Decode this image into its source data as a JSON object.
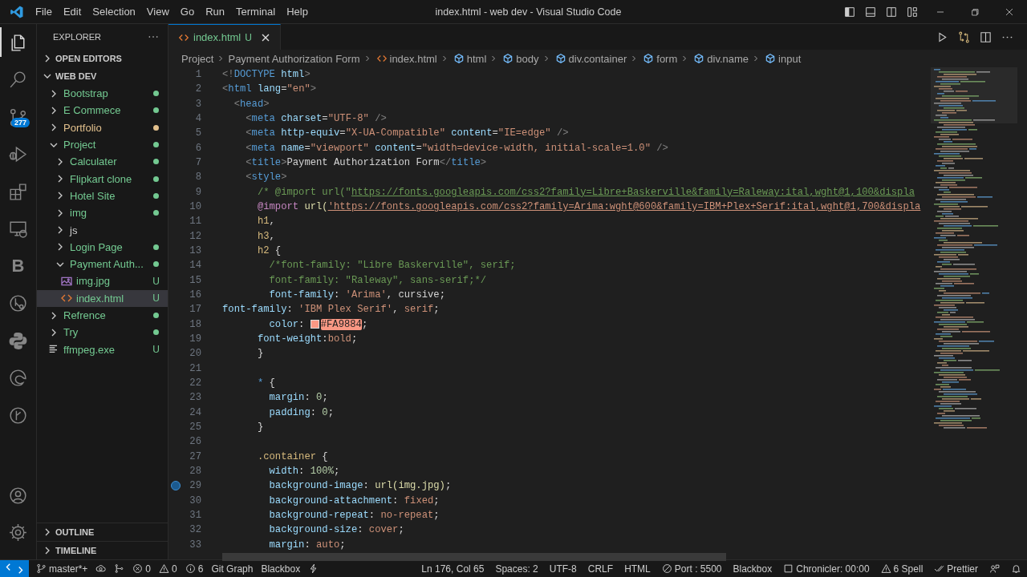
{
  "window": {
    "title": "index.html - web dev - Visual Studio Code"
  },
  "menu": [
    "File",
    "Edit",
    "Selection",
    "View",
    "Go",
    "Run",
    "Terminal",
    "Help"
  ],
  "activity_bar": {
    "top": [
      {
        "kind": "files",
        "selected": true
      },
      {
        "kind": "search",
        "selected": false
      },
      {
        "kind": "source-control",
        "selected": false,
        "badge": "277"
      },
      {
        "kind": "run-debug",
        "selected": false
      },
      {
        "kind": "extensions",
        "selected": false
      },
      {
        "kind": "remote",
        "selected": false
      },
      {
        "kind": "letter",
        "selected": false,
        "text": "B"
      },
      {
        "kind": "git-lens",
        "selected": false
      },
      {
        "kind": "python",
        "selected": false
      },
      {
        "kind": "edge",
        "selected": false
      },
      {
        "kind": "git-graph",
        "selected": false
      }
    ],
    "bottom": [
      {
        "kind": "account"
      },
      {
        "kind": "settings"
      }
    ]
  },
  "sidebar": {
    "title": "EXPLORER",
    "sections": [
      {
        "label": "OPEN EDITORS",
        "expanded": false
      },
      {
        "label": "WEB DEV",
        "expanded": true,
        "items": [
          {
            "name": "Bootstrap",
            "kind": "folder",
            "expanded": false,
            "color": "#73c991",
            "dot": true,
            "selected": false
          },
          {
            "name": "E Commece",
            "kind": "folder",
            "expanded": false,
            "color": "#73c991",
            "dot": true,
            "selected": false
          },
          {
            "name": "Portfolio",
            "kind": "folder",
            "expanded": false,
            "color": "#e2c08d",
            "dot": true,
            "selected": false
          },
          {
            "name": "Project",
            "kind": "folder",
            "expanded": true,
            "color": "#73c991",
            "dot": true,
            "selected": false,
            "children": [
              {
                "name": "Calculater",
                "kind": "folder",
                "expanded": false,
                "color": "#73c991",
                "dot": true,
                "selected": false
              },
              {
                "name": "Flipkart clone",
                "kind": "folder",
                "expanded": false,
                "color": "#73c991",
                "dot": true,
                "selected": false
              },
              {
                "name": "Hotel Site",
                "kind": "folder",
                "expanded": false,
                "color": "#73c991",
                "dot": true,
                "selected": false
              },
              {
                "name": "img",
                "kind": "folder",
                "expanded": false,
                "color": "#73c991",
                "dot": true,
                "selected": false
              },
              {
                "name": "js",
                "kind": "folder",
                "expanded": false,
                "color": "#cccccc",
                "dot": false,
                "selected": false
              },
              {
                "name": "Login Page",
                "kind": "folder",
                "expanded": false,
                "color": "#73c991",
                "dot": true,
                "selected": false
              },
              {
                "name": "Payment Auth...",
                "kind": "folder",
                "expanded": true,
                "color": "#73c991",
                "dot": true,
                "selected": false,
                "children": [
                  {
                    "name": "img.jpg",
                    "kind": "image",
                    "color": "#73c991",
                    "dot": false,
                    "badge": "U",
                    "selected": false
                  },
                  {
                    "name": "index.html",
                    "kind": "html",
                    "color": "#73c991",
                    "dot": false,
                    "badge": "U",
                    "selected": true
                  }
                ]
              }
            ]
          },
          {
            "name": "Refrence",
            "kind": "folder",
            "expanded": false,
            "color": "#73c991",
            "dot": true,
            "selected": false
          },
          {
            "name": "Try",
            "kind": "folder",
            "expanded": false,
            "color": "#73c991",
            "dot": true,
            "selected": false
          },
          {
            "name": "ffmpeg.exe",
            "kind": "text",
            "color": "#73c991",
            "dot": false,
            "badge": "U",
            "selected": false
          }
        ]
      },
      {
        "label": "OUTLINE",
        "expanded": false
      },
      {
        "label": "TIMELINE",
        "expanded": false
      }
    ]
  },
  "editor": {
    "tabs": [
      {
        "label": "index.html",
        "badge": "U",
        "selected": true
      }
    ],
    "breadcrumbs": [
      {
        "text": "Project",
        "kind": "folder"
      },
      {
        "text": "Payment Authorization Form",
        "kind": "folder"
      },
      {
        "text": "index.html",
        "kind": "file"
      },
      {
        "text": "html",
        "kind": "element"
      },
      {
        "text": "body",
        "kind": "element"
      },
      {
        "text": "div.container",
        "kind": "element"
      },
      {
        "text": "form",
        "kind": "element"
      },
      {
        "text": "div.name",
        "kind": "element"
      },
      {
        "text": "input",
        "kind": "element"
      }
    ],
    "lines": [
      {
        "n": "1",
        "marker": false,
        "tokens": [
          {
            "kind": "punct",
            "text": "<!"
          },
          {
            "kind": "tag",
            "text": "DOCTYPE"
          },
          {
            "kind": "attr",
            "text": " html"
          },
          {
            "kind": "punct",
            "text": ">"
          }
        ]
      },
      {
        "n": "2",
        "marker": false,
        "tokens": [
          {
            "kind": "punct",
            "text": "<"
          },
          {
            "kind": "tag",
            "text": "html"
          },
          {
            "kind": "attr",
            "text": " lang"
          },
          {
            "kind": "plain",
            "text": "="
          },
          {
            "kind": "string",
            "text": "\"en\""
          },
          {
            "kind": "punct",
            "text": ">"
          }
        ]
      },
      {
        "n": "3",
        "marker": false,
        "tokens": [
          {
            "kind": "punct",
            "text": "  <"
          },
          {
            "kind": "tag",
            "text": "head"
          },
          {
            "kind": "punct",
            "text": ">"
          }
        ]
      },
      {
        "n": "4",
        "marker": false,
        "tokens": [
          {
            "kind": "punct",
            "text": "    <"
          },
          {
            "kind": "tag",
            "text": "meta"
          },
          {
            "kind": "attr",
            "text": " charset"
          },
          {
            "kind": "plain",
            "text": "="
          },
          {
            "kind": "string",
            "text": "\"UTF-8\""
          },
          {
            "kind": "punct",
            "text": " />"
          }
        ]
      },
      {
        "n": "5",
        "marker": false,
        "tokens": [
          {
            "kind": "punct",
            "text": "    <"
          },
          {
            "kind": "tag",
            "text": "meta"
          },
          {
            "kind": "attr",
            "text": " http-equiv"
          },
          {
            "kind": "plain",
            "text": "="
          },
          {
            "kind": "string",
            "text": "\"X-UA-Compatible\""
          },
          {
            "kind": "attr",
            "text": " content"
          },
          {
            "kind": "plain",
            "text": "="
          },
          {
            "kind": "string",
            "text": "\"IE=edge\""
          },
          {
            "kind": "punct",
            "text": " />"
          }
        ]
      },
      {
        "n": "6",
        "marker": false,
        "tokens": [
          {
            "kind": "punct",
            "text": "    <"
          },
          {
            "kind": "tag",
            "text": "meta"
          },
          {
            "kind": "attr",
            "text": " name"
          },
          {
            "kind": "plain",
            "text": "="
          },
          {
            "kind": "string",
            "text": "\"viewport\""
          },
          {
            "kind": "attr",
            "text": " content"
          },
          {
            "kind": "plain",
            "text": "="
          },
          {
            "kind": "string",
            "text": "\"width=device-width, initial-scale=1.0\""
          },
          {
            "kind": "punct",
            "text": " />"
          }
        ]
      },
      {
        "n": "7",
        "marker": false,
        "tokens": [
          {
            "kind": "punct",
            "text": "    <"
          },
          {
            "kind": "tag",
            "text": "title"
          },
          {
            "kind": "punct",
            "text": ">"
          },
          {
            "kind": "plain",
            "text": "Payment Authorization Form"
          },
          {
            "kind": "punct",
            "text": "</"
          },
          {
            "kind": "tag",
            "text": "title"
          },
          {
            "kind": "punct",
            "text": ">"
          }
        ]
      },
      {
        "n": "8",
        "marker": false,
        "tokens": [
          {
            "kind": "punct",
            "text": "    <"
          },
          {
            "kind": "tag",
            "text": "style"
          },
          {
            "kind": "punct",
            "text": ">"
          }
        ]
      },
      {
        "n": "9",
        "marker": false,
        "tokens": [
          {
            "kind": "comment",
            "text": "      /* @import url(\""
          },
          {
            "kind": "comment-link",
            "text": "https://fonts.googleapis.com/css2?family=Libre+Baskerville&family=Raleway:ital,wght@1,100&displa"
          }
        ]
      },
      {
        "n": "10",
        "marker": false,
        "tokens": [
          {
            "kind": "keyword",
            "text": "      @import"
          },
          {
            "kind": "func",
            "text": " url("
          },
          {
            "kind": "string-link",
            "text": "'https://fonts.googleapis.com/css2?family=Arima:wght@600&family=IBM+Plex+Serif:ital,wght@1,700&displa"
          }
        ]
      },
      {
        "n": "11",
        "marker": false,
        "tokens": [
          {
            "kind": "selector",
            "text": "      h1"
          },
          {
            "kind": "plain",
            "text": ","
          }
        ]
      },
      {
        "n": "12",
        "marker": false,
        "tokens": [
          {
            "kind": "selector",
            "text": "      h3"
          },
          {
            "kind": "plain",
            "text": ","
          }
        ]
      },
      {
        "n": "13",
        "marker": false,
        "tokens": [
          {
            "kind": "selector",
            "text": "      h2"
          },
          {
            "kind": "plain",
            "text": " {"
          }
        ]
      },
      {
        "n": "14",
        "marker": false,
        "tokens": [
          {
            "kind": "comment",
            "text": "        /*font-family: \"Libre Baskerville\", serif;"
          }
        ]
      },
      {
        "n": "15",
        "marker": false,
        "tokens": [
          {
            "kind": "comment",
            "text": "        font-family: \"Raleway\", sans-serif;*/"
          }
        ]
      },
      {
        "n": "16",
        "marker": false,
        "tokens": [
          {
            "kind": "property",
            "text": "        font-family"
          },
          {
            "kind": "plain",
            "text": ": "
          },
          {
            "kind": "value",
            "text": "'Arima'"
          },
          {
            "kind": "plain",
            "text": ", cursive;"
          }
        ]
      },
      {
        "n": "17",
        "marker": false,
        "tokens": [
          {
            "kind": "property",
            "text": "font-family"
          },
          {
            "kind": "plain",
            "text": ": "
          },
          {
            "kind": "value",
            "text": "'IBM Plex Serif'"
          },
          {
            "kind": "plain",
            "text": ", "
          },
          {
            "kind": "value",
            "text": "serif"
          },
          {
            "kind": "plain",
            "text": ";"
          }
        ]
      },
      {
        "n": "18",
        "marker": false,
        "tokens": [
          {
            "kind": "property",
            "text": "        color"
          },
          {
            "kind": "plain",
            "text": ": "
          },
          {
            "kind": "color",
            "text": "#FA9884",
            "color": "#fa9884"
          },
          {
            "kind": "plain",
            "text": ";"
          }
        ]
      },
      {
        "n": "19",
        "marker": false,
        "tokens": [
          {
            "kind": "property",
            "text": "      font-weight"
          },
          {
            "kind": "plain",
            "text": ":"
          },
          {
            "kind": "value",
            "text": "bold"
          },
          {
            "kind": "plain",
            "text": ";"
          }
        ]
      },
      {
        "n": "20",
        "marker": false,
        "tokens": [
          {
            "kind": "plain",
            "text": "      }"
          }
        ]
      },
      {
        "n": "21",
        "marker": false
      },
      {
        "n": "22",
        "marker": false,
        "tokens": [
          {
            "kind": "tag",
            "text": "      *"
          },
          {
            "kind": "plain",
            "text": " {"
          }
        ]
      },
      {
        "n": "23",
        "marker": false,
        "tokens": [
          {
            "kind": "property",
            "text": "        margin"
          },
          {
            "kind": "plain",
            "text": ": "
          },
          {
            "kind": "number",
            "text": "0"
          },
          {
            "kind": "plain",
            "text": ";"
          }
        ]
      },
      {
        "n": "24",
        "marker": false,
        "tokens": [
          {
            "kind": "property",
            "text": "        padding"
          },
          {
            "kind": "plain",
            "text": ": "
          },
          {
            "kind": "number",
            "text": "0"
          },
          {
            "kind": "plain",
            "text": ";"
          }
        ]
      },
      {
        "n": "25",
        "marker": false,
        "tokens": [
          {
            "kind": "plain",
            "text": "      }"
          }
        ]
      },
      {
        "n": "26",
        "marker": false
      },
      {
        "n": "27",
        "marker": false,
        "tokens": [
          {
            "kind": "selector",
            "text": "      .container"
          },
          {
            "kind": "plain",
            "text": " {"
          }
        ]
      },
      {
        "n": "28",
        "marker": false,
        "tokens": [
          {
            "kind": "property",
            "text": "        width"
          },
          {
            "kind": "plain",
            "text": ": "
          },
          {
            "kind": "number",
            "text": "100%"
          },
          {
            "kind": "plain",
            "text": ";"
          }
        ]
      },
      {
        "n": "29",
        "marker": true,
        "tokens": [
          {
            "kind": "property",
            "text": "        background-image"
          },
          {
            "kind": "plain",
            "text": ": "
          },
          {
            "kind": "func",
            "text": "url(img.jpg)"
          },
          {
            "kind": "plain",
            "text": ";"
          }
        ]
      },
      {
        "n": "30",
        "marker": false,
        "tokens": [
          {
            "kind": "property",
            "text": "        background-attachment"
          },
          {
            "kind": "plain",
            "text": ": "
          },
          {
            "kind": "value",
            "text": "fixed"
          },
          {
            "kind": "plain",
            "text": ";"
          }
        ]
      },
      {
        "n": "31",
        "marker": false,
        "tokens": [
          {
            "kind": "property",
            "text": "        background-repeat"
          },
          {
            "kind": "plain",
            "text": ": "
          },
          {
            "kind": "value",
            "text": "no-repeat"
          },
          {
            "kind": "plain",
            "text": ";"
          }
        ]
      },
      {
        "n": "32",
        "marker": false,
        "tokens": [
          {
            "kind": "property",
            "text": "        background-size"
          },
          {
            "kind": "plain",
            "text": ": "
          },
          {
            "kind": "value",
            "text": "cover"
          },
          {
            "kind": "plain",
            "text": ";"
          }
        ]
      },
      {
        "n": "33",
        "marker": false,
        "tokens": [
          {
            "kind": "property",
            "text": "        margin"
          },
          {
            "kind": "plain",
            "text": ": "
          },
          {
            "kind": "value",
            "text": "auto"
          },
          {
            "kind": "plain",
            "text": ";"
          }
        ]
      }
    ]
  },
  "status_bar": {
    "left": [
      {
        "kind": "branch",
        "text": "master*+"
      },
      {
        "kind": "sync"
      },
      {
        "kind": "graph"
      },
      {
        "kind": "error",
        "text": "0"
      },
      {
        "kind": "warning",
        "text": "0"
      },
      {
        "kind": "info",
        "text": "6"
      },
      {
        "text": "Git Graph"
      },
      {
        "text": "Blackbox"
      },
      {
        "kind": "bolt"
      }
    ],
    "right": [
      {
        "text": "Ln 176, Col 65"
      },
      {
        "text": "Spaces: 2"
      },
      {
        "text": "UTF-8"
      },
      {
        "text": "CRLF"
      },
      {
        "text": "HTML"
      },
      {
        "kind": "port",
        "text": "Port : 5500"
      },
      {
        "text": "Blackbox"
      },
      {
        "kind": "square",
        "text": "Chronicler: 00:00"
      },
      {
        "kind": "warning",
        "text": "6 Spell"
      },
      {
        "kind": "checks",
        "text": "Prettier"
      },
      {
        "kind": "feedback"
      },
      {
        "kind": "bell"
      }
    ]
  }
}
